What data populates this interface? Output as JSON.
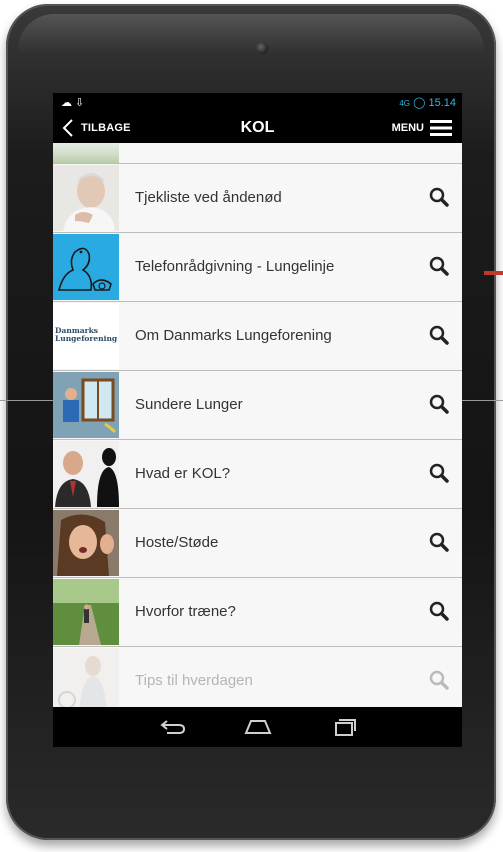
{
  "status": {
    "left_icons": "☁ ⇩",
    "signal": "4G",
    "time": "15.14"
  },
  "actionbar": {
    "back_label": "TILBAGE",
    "title": "KOL",
    "menu_label": "MENU"
  },
  "list": {
    "items": [
      {
        "label": "Tjekliste ved åndenød",
        "thumb": "elderly-man-photo"
      },
      {
        "label": "Telefonrådgivning - Lungelinje",
        "thumb": "phone-drawing"
      },
      {
        "label": "Om Danmarks Lungeforening",
        "thumb": "lungeforening-logo",
        "logo_text_1": "Danmarks",
        "logo_text_2": "Lungeforening"
      },
      {
        "label": "Sundere Lunger",
        "thumb": "window-illustration"
      },
      {
        "label": "Hvad er KOL?",
        "thumb": "men-photo"
      },
      {
        "label": "Hoste/Støde",
        "thumb": "coughing-woman-photo"
      },
      {
        "label": "Hvorfor træne?",
        "thumb": "park-path-photo"
      },
      {
        "label": "Tips til hverdagen",
        "thumb": "woman-photo"
      }
    ]
  },
  "colors": {
    "accent": "#33b5e5",
    "text": "#333333",
    "divider": "#bdbdbd"
  }
}
